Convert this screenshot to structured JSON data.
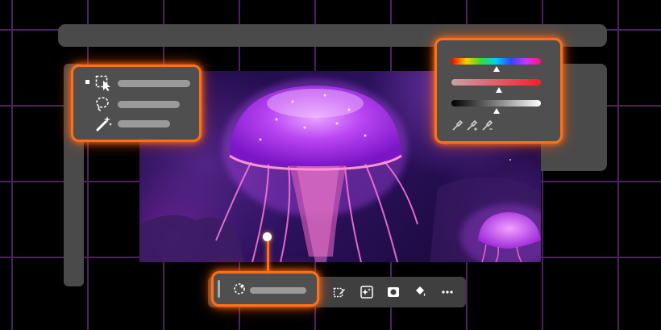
{
  "window": {
    "bars": [
      "top-bar",
      "left-toolbar",
      "right-properties-panel"
    ]
  },
  "canvas": {
    "subject": "jellyfish-image"
  },
  "tools_callout": {
    "items": [
      {
        "icon": "object-selection-icon",
        "label_fill": 1.0
      },
      {
        "icon": "lasso-icon",
        "label_fill": 0.85
      },
      {
        "icon": "magic-wand-icon",
        "label_fill": 0.72
      }
    ],
    "accent": "#ff6f19"
  },
  "colors_callout": {
    "sliders": [
      {
        "name": "hue-slider",
        "stops": [
          "#ff0000",
          "#ffcc00",
          "#33dd33",
          "#00ccff",
          "#3344ff",
          "#cc33ff",
          "#ff1177"
        ],
        "level": 0.52
      },
      {
        "name": "saturation-slider",
        "stops": [
          "#c9a0a8",
          "#ff1a2b"
        ],
        "level": 0.55
      },
      {
        "name": "lightness-slider",
        "stops": [
          "#000000",
          "#ffffff"
        ],
        "level": 0.5
      }
    ],
    "eyedroppers": [
      "eyedropper-icon",
      "eyedropper-plus-icon",
      "eyedropper-minus-icon"
    ]
  },
  "status_callout": {
    "icon": "loading-icon",
    "progress": 1.0
  },
  "context_toolbar": {
    "icons": [
      "edit-selection-icon",
      "generative-fill-icon",
      "mask-icon",
      "paint-bucket-icon",
      "more-icon"
    ]
  }
}
